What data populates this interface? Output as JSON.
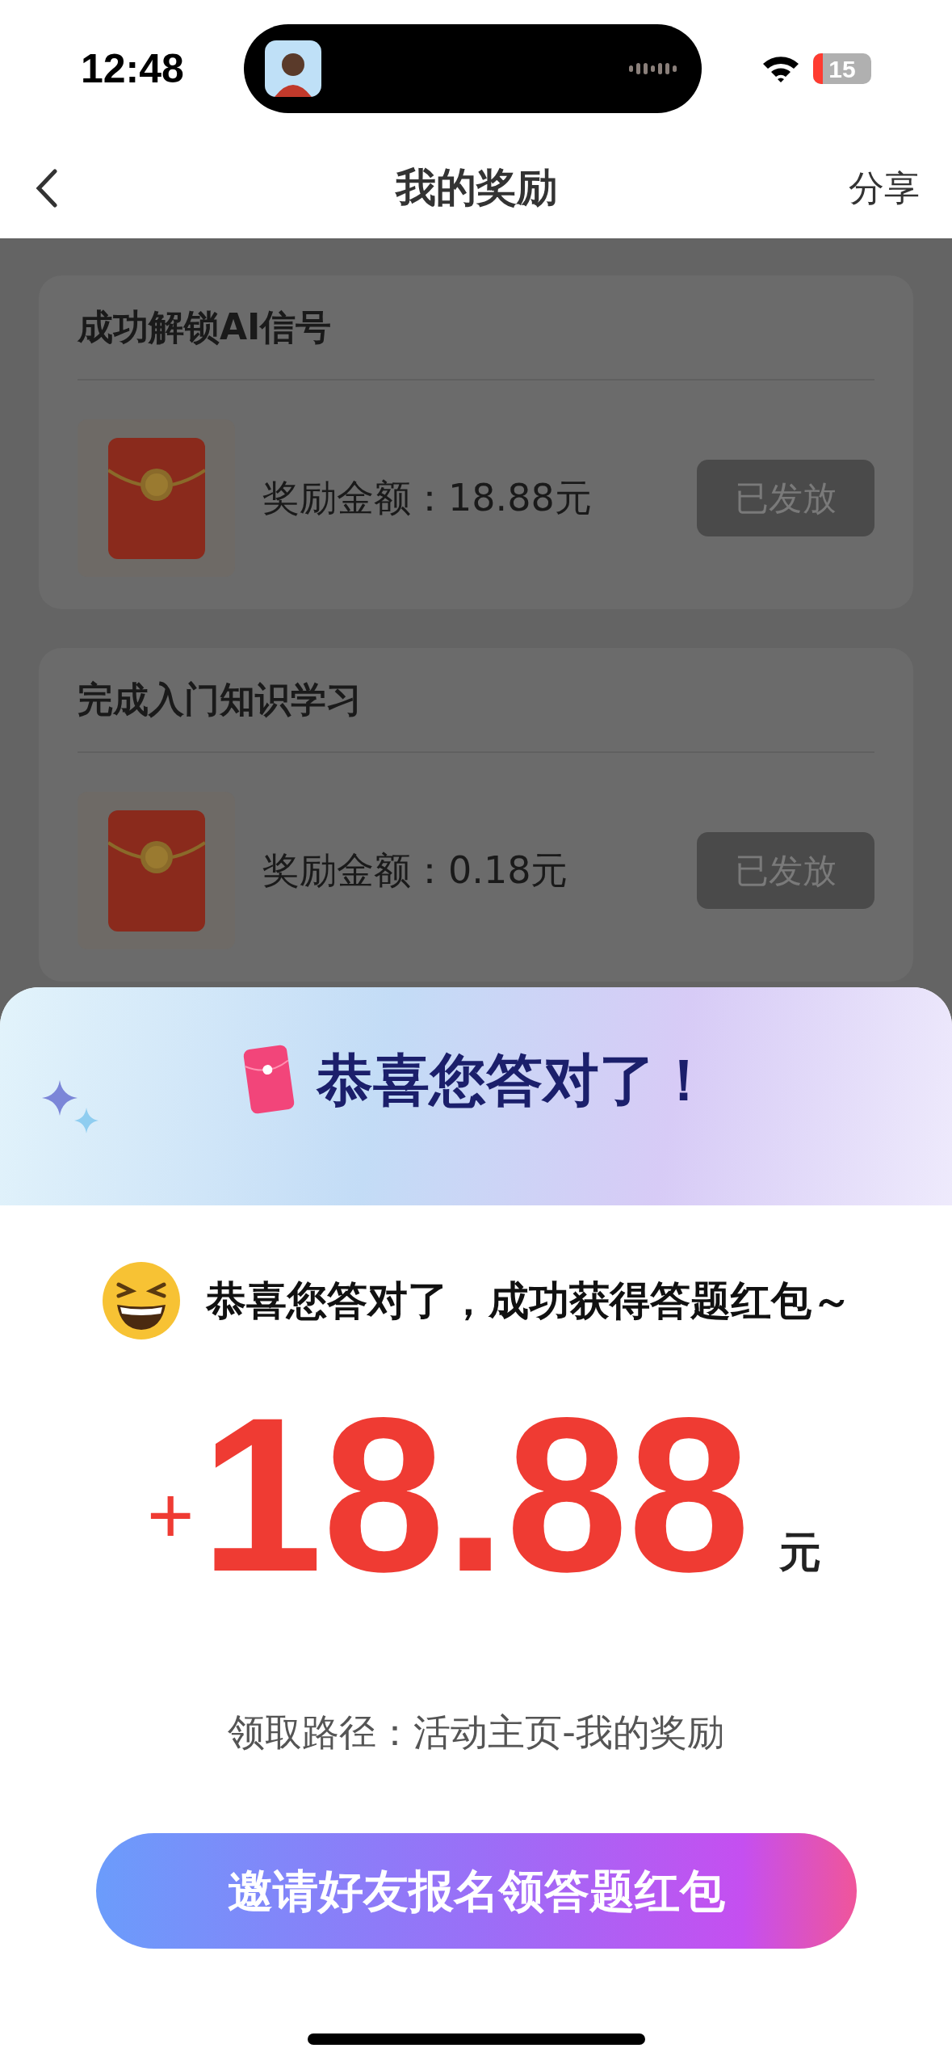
{
  "status_bar": {
    "time": "12:48",
    "battery": "15"
  },
  "nav": {
    "title": "我的奖励",
    "action": "分享"
  },
  "rewards": [
    {
      "title": "成功解锁AI信号",
      "amount_label": "奖励金额：18.88元",
      "status": "已发放"
    },
    {
      "title": "完成入门知识学习",
      "amount_label": "奖励金额：0.18元",
      "status": "已发放"
    }
  ],
  "dialog": {
    "title": "恭喜您答对了！",
    "message": "恭喜您答对了，成功获得答题红包～",
    "sign": "+",
    "amount": "18.88",
    "unit": "元",
    "path": "领取路径：活动主页-我的奖励",
    "button": "邀请好友报名领答题红包"
  }
}
